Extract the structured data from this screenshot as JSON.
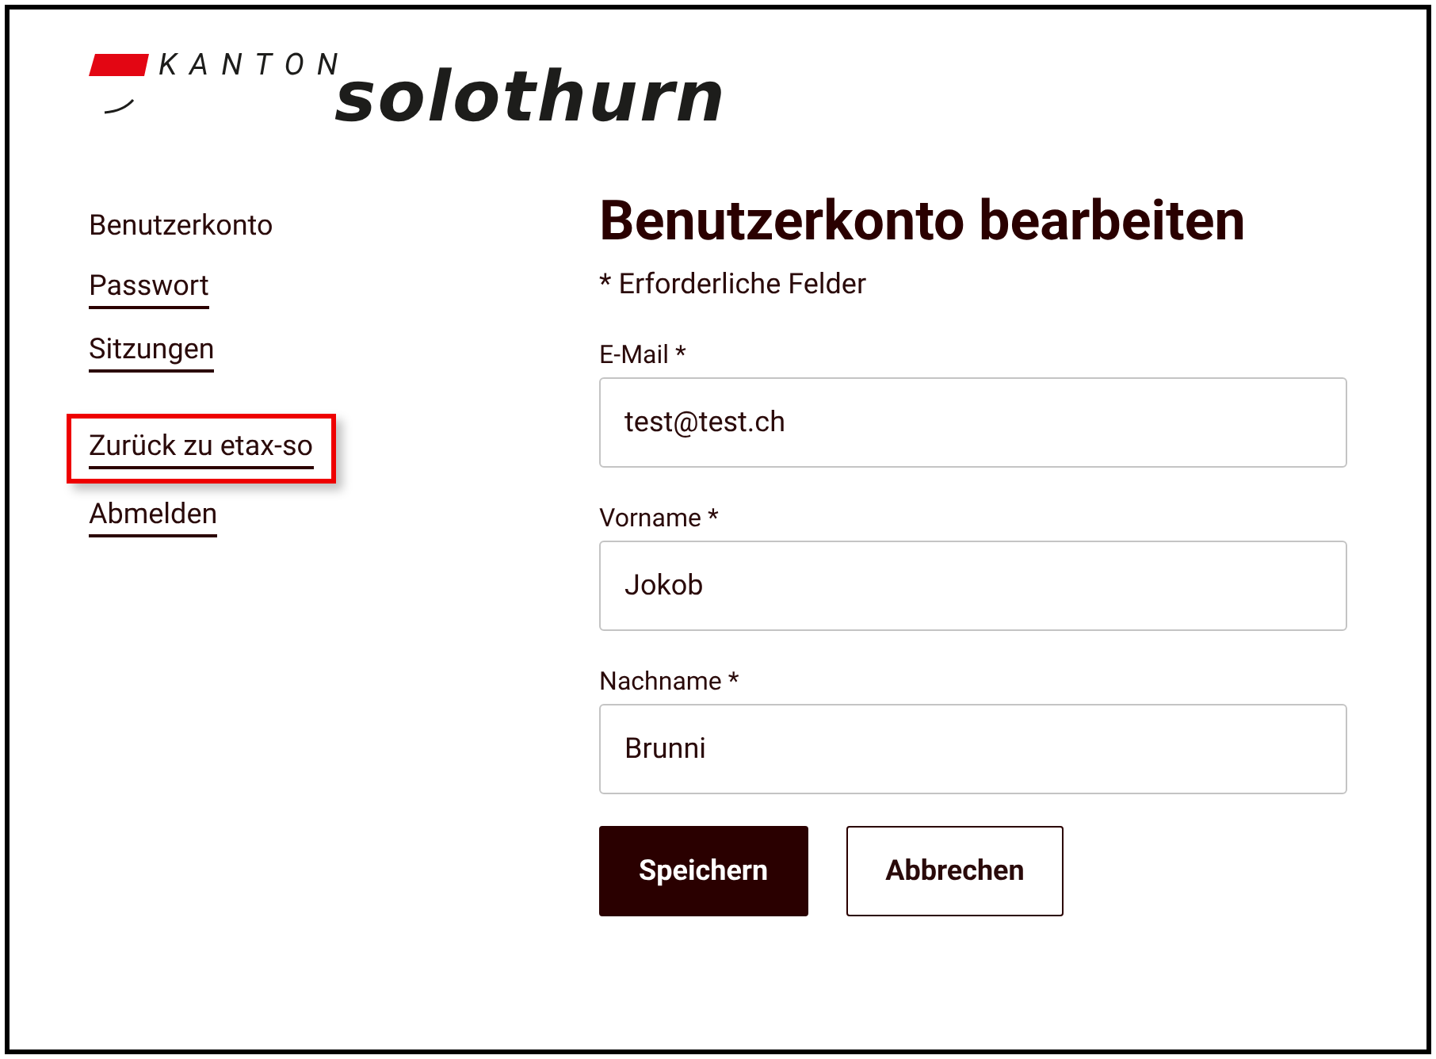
{
  "logo": {
    "prefix": "KANTON",
    "name": "solothurn"
  },
  "sidebar": {
    "groups": [
      {
        "items": [
          {
            "label": "Benutzerkonto",
            "selected": true,
            "highlighted": false
          },
          {
            "label": "Passwort",
            "selected": false,
            "highlighted": false
          },
          {
            "label": "Sitzungen",
            "selected": false,
            "highlighted": false
          }
        ]
      },
      {
        "items": [
          {
            "label": "Zurück zu etax-so",
            "selected": false,
            "highlighted": true
          },
          {
            "label": "Abmelden",
            "selected": false,
            "highlighted": false
          }
        ]
      }
    ]
  },
  "form": {
    "title": "Benutzerkonto bearbeiten",
    "required_note": "* Erforderliche Felder",
    "fields": [
      {
        "label": "E-Mail",
        "required_mark": "*",
        "value": "test@test.ch"
      },
      {
        "label": "Vorname",
        "required_mark": "*",
        "value": "Jokob"
      },
      {
        "label": "Nachname",
        "required_mark": "*",
        "value": "Brunni"
      }
    ],
    "buttons": [
      {
        "label": "Speichern",
        "kind": "primary"
      },
      {
        "label": "Abbrechen",
        "kind": "secondary"
      }
    ]
  }
}
